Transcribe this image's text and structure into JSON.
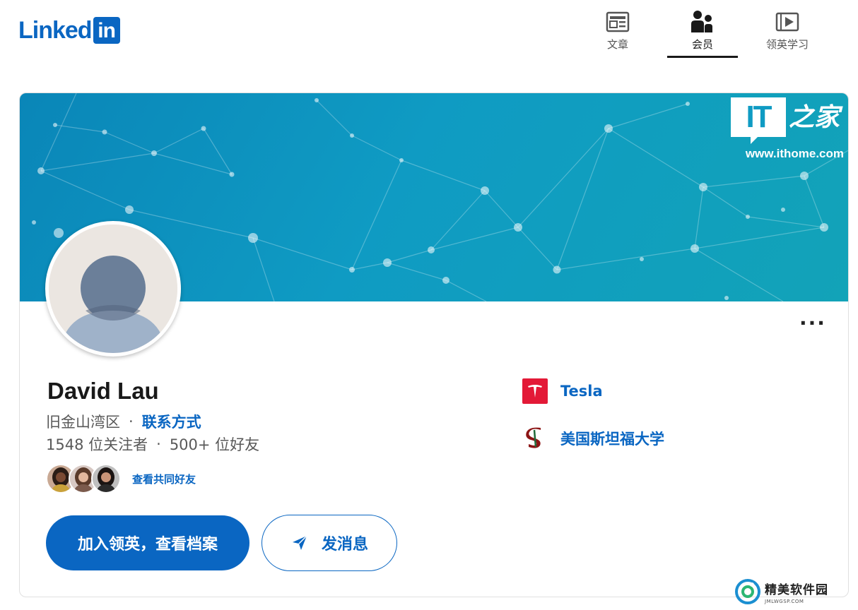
{
  "brand": {
    "logo_word": "Linked",
    "logo_box": "in",
    "accent": "#0a66c2"
  },
  "nav": {
    "items": [
      {
        "label": "文章",
        "icon": "article-icon",
        "active": false
      },
      {
        "label": "会员",
        "icon": "people-icon",
        "active": true
      },
      {
        "label": "领英学习",
        "icon": "learning-video-icon",
        "active": false
      }
    ]
  },
  "banner": {
    "watermark_logo": "IT",
    "watermark_cn": "之家",
    "watermark_url": "www.ithome.com"
  },
  "profile": {
    "name": "David Lau",
    "location": "旧金山湾区",
    "separator": "·",
    "contact_link": "联系方式",
    "followers": "1548 位关注者",
    "connections": "500+ 位好友",
    "mutual_link": "查看共同好友",
    "more_label": "···"
  },
  "actions": {
    "primary": "加入领英，查看档案",
    "secondary": "发消息"
  },
  "affiliations": [
    {
      "label": "Tesla",
      "icon": "tesla-logo-icon"
    },
    {
      "label": "美国斯坦福大学",
      "icon": "stanford-logo-icon"
    }
  ],
  "corner_watermark": {
    "title": "精美软件园",
    "sub": "JMLWGSP.COM"
  }
}
